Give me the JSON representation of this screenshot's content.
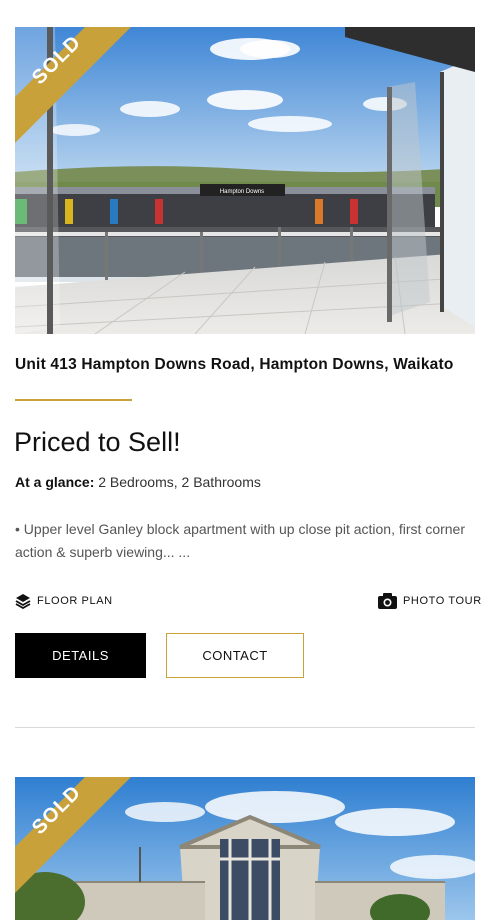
{
  "listings": [
    {
      "badge": "SOLD",
      "address": "Unit 413 Hampton Downs Road, Hampton Downs, Waikato",
      "headline": "Priced to Sell!",
      "glance_label": "At a glance:",
      "glance_value": "2 Bedrooms, 2 Bathrooms",
      "description": "• Upper level Ganley block apartment with up close pit action, first corner action & superb viewing... ...",
      "floor_plan_label": "FLOOR PLAN",
      "photo_tour_label": "PHOTO TOUR",
      "details_label": "DETAILS",
      "contact_label": "CONTACT",
      "sign_text": "Hampton Downs"
    },
    {
      "badge": "SOLD"
    }
  ],
  "colors": {
    "gold": "#c9a13b",
    "black": "#000000",
    "divider": "#d9d9d9"
  },
  "icons": [
    "layers-icon",
    "camera-icon"
  ]
}
